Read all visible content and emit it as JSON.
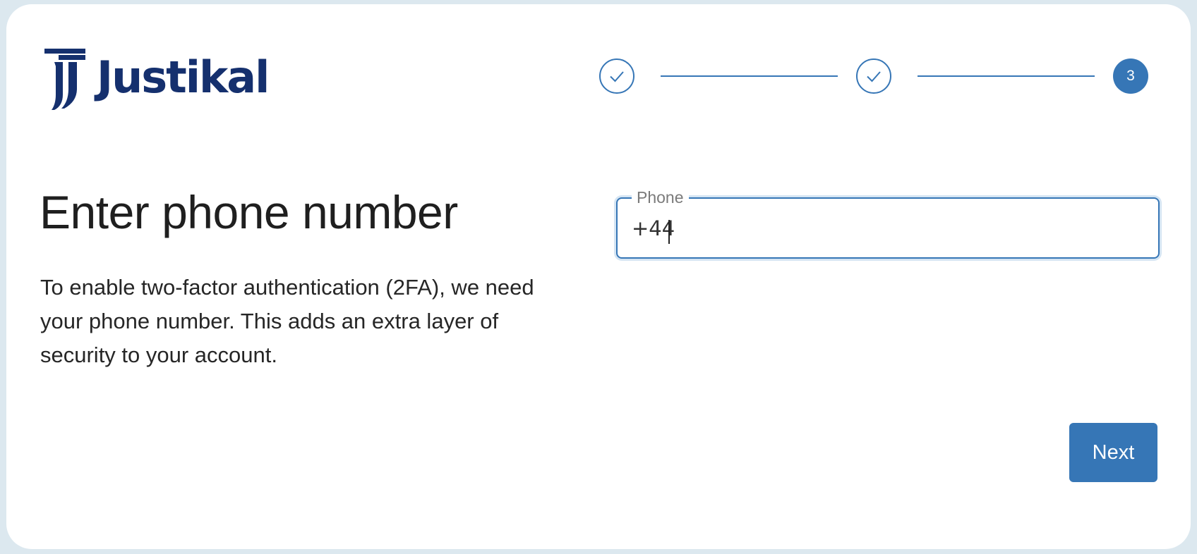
{
  "brand": {
    "name": "Justikal",
    "color": "#15306e"
  },
  "stepper": {
    "steps": [
      {
        "state": "completed",
        "icon": "check-icon"
      },
      {
        "state": "completed",
        "icon": "check-icon"
      },
      {
        "state": "active",
        "label": "3"
      }
    ],
    "accent": "#3676b6"
  },
  "main": {
    "title": "Enter phone number",
    "description": "To enable two-factor authentication (2FA), we need your phone number. This adds an extra layer of security to your account."
  },
  "phone_field": {
    "label": "Phone",
    "value": "+44"
  },
  "actions": {
    "next_label": "Next"
  }
}
